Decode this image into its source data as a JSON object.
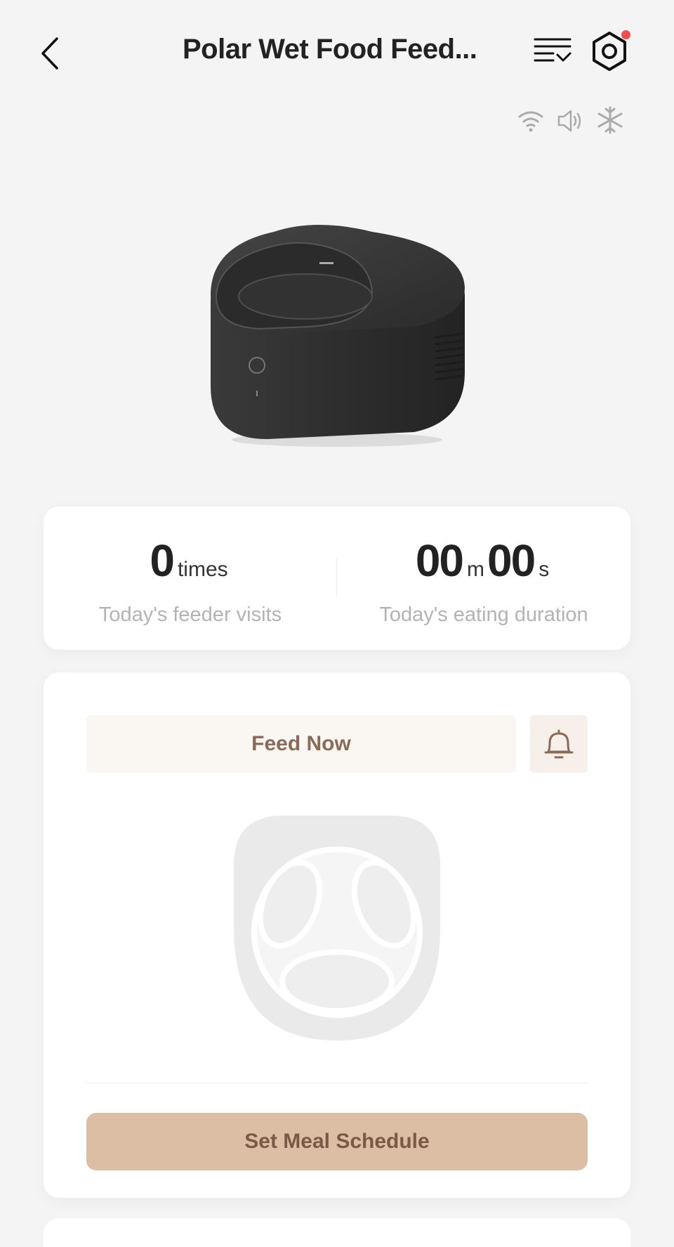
{
  "header": {
    "title": "Polar Wet Food Feed...",
    "back_icon": "chevron-left-icon",
    "list_icon": "checklist-icon",
    "settings_icon": "hexagon-settings-icon",
    "notification_dot_color": "#ee4d4f"
  },
  "status": {
    "icons": [
      "wifi-icon",
      "speaker-icon",
      "snowflake-icon"
    ]
  },
  "stats": {
    "visits": {
      "value": "0",
      "unit": "times",
      "label": "Today's feeder visits"
    },
    "duration": {
      "minutes": "00",
      "minutes_unit": "m",
      "seconds": "00",
      "seconds_unit": "s",
      "label": "Today's eating duration"
    }
  },
  "feed": {
    "feed_now_label": "Feed Now",
    "bell_icon": "bell-icon",
    "schedule_label": "Set Meal Schedule",
    "accent_color": "#dcbea5",
    "accent_text_color": "#7a5a46"
  }
}
